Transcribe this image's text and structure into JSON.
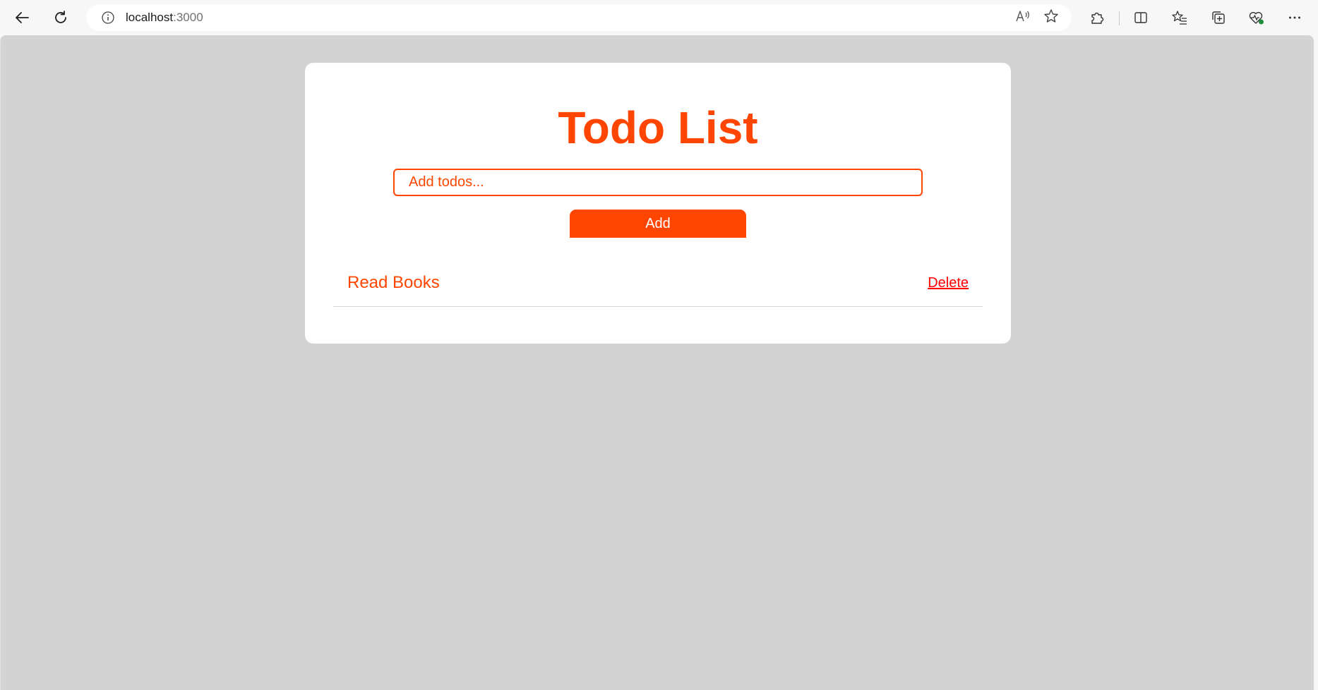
{
  "browser": {
    "url_host": "localhost",
    "url_port": ":3000",
    "icons": {
      "back": "back-arrow-icon",
      "refresh": "refresh-icon",
      "info": "info-icon",
      "read_aloud": "read-aloud-icon",
      "favorite": "star-icon",
      "extensions": "puzzle-icon",
      "split_screen": "split-screen-icon",
      "favorites": "favorites-list-icon",
      "collections": "collections-icon",
      "browser_essentials": "heart-pulse-icon",
      "more": "more-icon"
    }
  },
  "app": {
    "title": "Todo List",
    "input_placeholder": "Add todos...",
    "add_label": "Add",
    "accent_color": "#ff4500",
    "todos": [
      {
        "text": "Read Books",
        "delete_label": "Delete"
      }
    ]
  }
}
